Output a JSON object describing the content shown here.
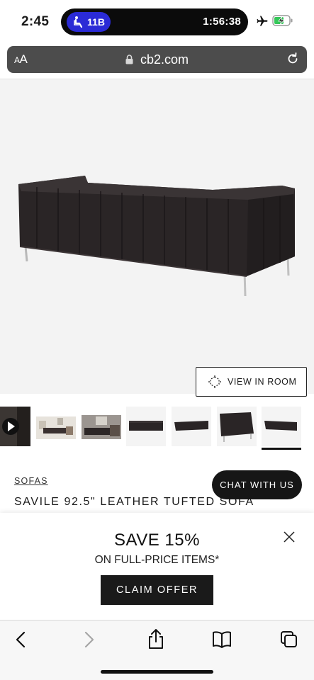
{
  "status_bar": {
    "time": "2:45",
    "live_activity": {
      "seat": "11B",
      "timer": "1:56:38"
    },
    "icons": [
      "airplane-icon",
      "battery-charging-icon",
      "person-seat-icon"
    ]
  },
  "browser": {
    "text_size_label_small": "A",
    "text_size_label_large": "A",
    "url": "cb2.com",
    "icons": [
      "lock-icon",
      "reload-icon"
    ]
  },
  "product": {
    "view_in_room_label": "VIEW IN ROOM",
    "category": "SOFAS",
    "title": "SAVILE 92.5\" LEATHER TUFTED SOFA",
    "thumbnail_count": 7,
    "selected_thumbnail": 7
  },
  "chat": {
    "label": "CHAT WITH US"
  },
  "promo": {
    "title": "SAVE 15%",
    "subtitle": "ON FULL-PRICE ITEMS*",
    "cta": "CLAIM OFFER"
  },
  "toolbar": {
    "icons": [
      "back-icon",
      "forward-icon",
      "share-icon",
      "bookmarks-icon",
      "tabs-icon"
    ]
  },
  "colors": {
    "dark": "#161616",
    "url_bar": "#4c4c4c",
    "island_pill": "#2b2bd6",
    "battery_green": "#35c759"
  }
}
